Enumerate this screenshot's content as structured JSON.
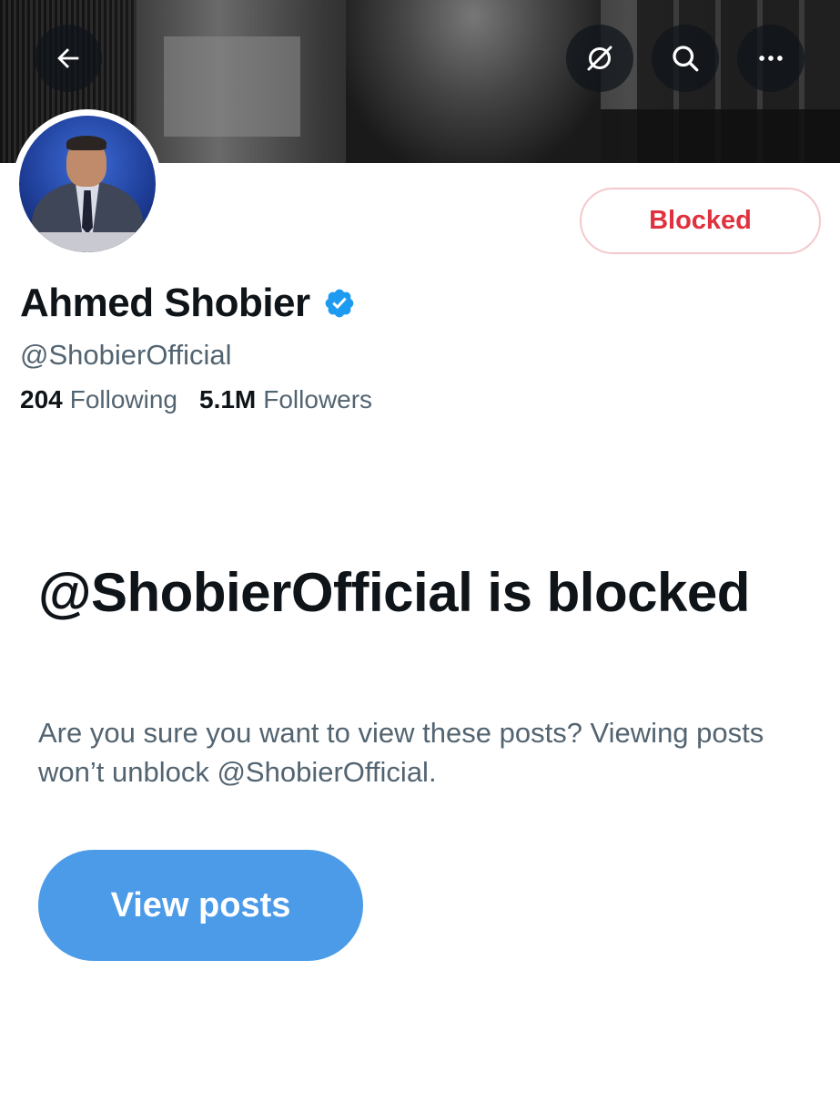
{
  "header": {
    "back_icon": "arrow-left-icon",
    "grok_icon": "grok-icon",
    "search_icon": "search-icon",
    "more_icon": "more-horizontal-icon",
    "button_background": "#0f1419"
  },
  "profile": {
    "display_name": "Ahmed Shobier",
    "handle": "@ShobierOfficial",
    "verified_icon": "verified-badge-icon",
    "verified_color": "#1d9bf0",
    "following_count": "204",
    "following_label": "Following",
    "followers_count": "5.1M",
    "followers_label": "Followers"
  },
  "blocked_button": {
    "label": "Blocked",
    "color": "#e0313e"
  },
  "notice": {
    "title": "@ShobierOfficial is blocked",
    "body": "Are you sure you want to view these posts? Viewing posts won’t unblock @ShobierOfficial.",
    "view_button_label": "View posts",
    "view_button_color": "#4b9be8"
  }
}
